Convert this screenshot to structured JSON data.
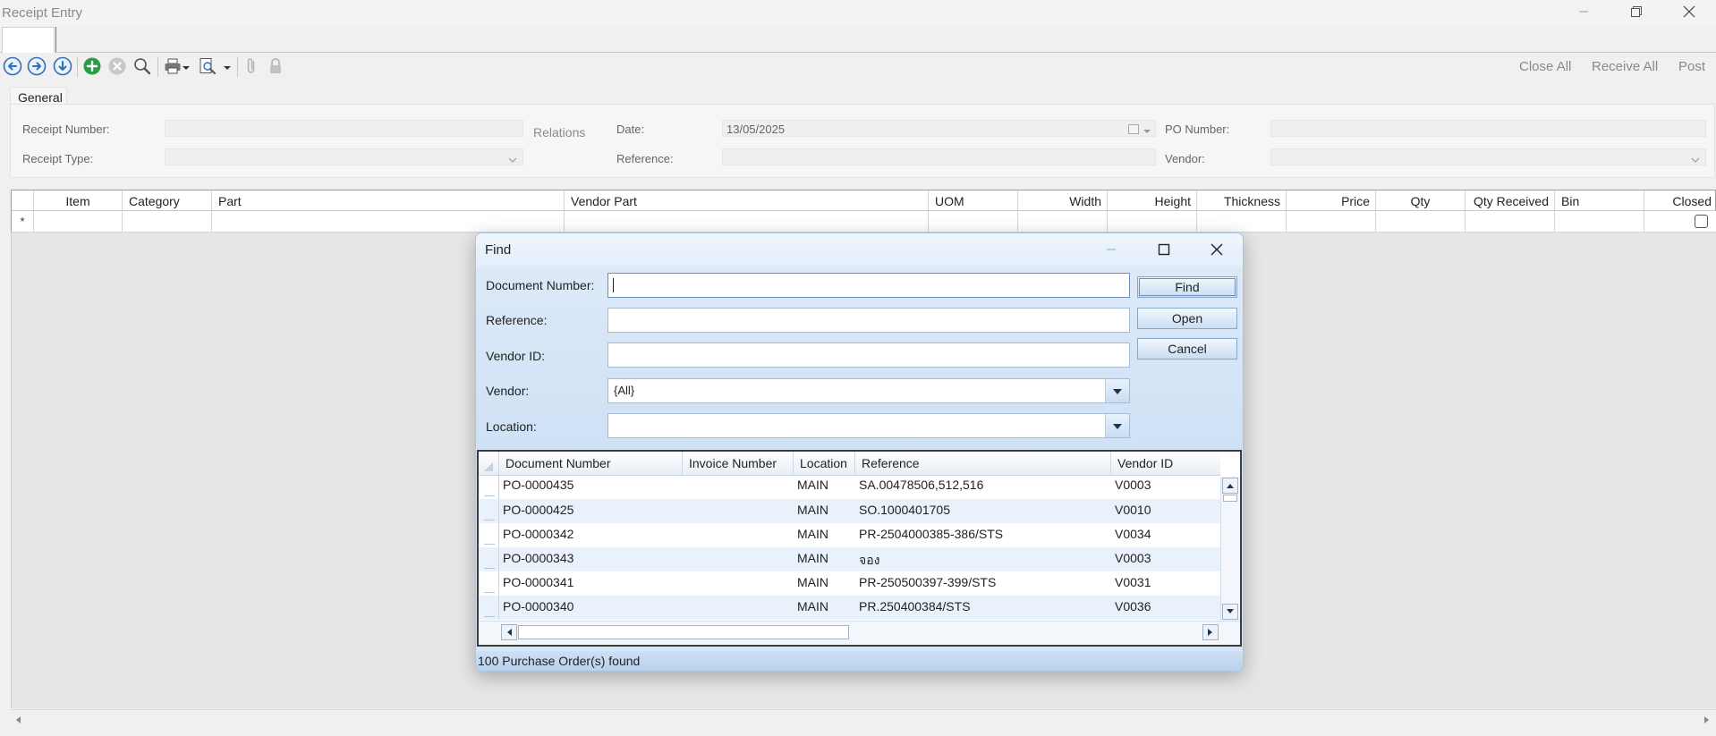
{
  "window": {
    "title": "Receipt Entry",
    "controls": [
      "minimize-icon",
      "restore-icon",
      "close-icon"
    ]
  },
  "toolbar": {
    "icons": [
      "arrow-left-icon",
      "arrow-right-icon",
      "arrow-down-icon",
      "add-icon",
      "delete-icon",
      "search-icon",
      "print-icon",
      "dropdown-arrow-icon",
      "preview-icon",
      "dropdown-arrow-icon",
      "paperclip-icon",
      "lock-icon"
    ],
    "close_all": "Close All",
    "receive_all": "Receive All",
    "post": "Post"
  },
  "form": {
    "tab_general": "General",
    "receipt_number_label": "Receipt Number:",
    "receipt_type_label": "Receipt Type:",
    "relations_label": "Relations",
    "date_label": "Date:",
    "date_value": "13/05/2025",
    "reference_label": "Reference:",
    "po_number_label": "PO Number:",
    "vendor_label": "Vendor:"
  },
  "grid": {
    "columns": [
      "Item",
      "Category",
      "Part",
      "Vendor Part",
      "UOM",
      "Width",
      "Height",
      "Thickness",
      "Price",
      "Qty",
      "Qty Received",
      "Bin",
      "Closed"
    ],
    "new_row_marker": "*"
  },
  "dialog": {
    "title": "Find",
    "document_number_label": "Document Number:",
    "document_number_value": "",
    "reference_label": "Reference:",
    "reference_value": "",
    "vendor_id_label": "Vendor ID:",
    "vendor_id_value": "",
    "vendor_label": "Vendor:",
    "vendor_value": "{All}",
    "location_label": "Location:",
    "location_value": "",
    "find_button": "Find",
    "open_button": "Open",
    "cancel_button": "Cancel",
    "columns": [
      "Document Number",
      "Invoice Number",
      "Location",
      "Reference",
      "Vendor ID"
    ],
    "rows": [
      {
        "document_number": "PO-0000435",
        "invoice_number": "",
        "location": "MAIN",
        "reference": "SA.00478506,512,516",
        "vendor_id": "V0003"
      },
      {
        "document_number": "PO-0000425",
        "invoice_number": "",
        "location": "MAIN",
        "reference": "SO.1000401705",
        "vendor_id": "V0010"
      },
      {
        "document_number": "PO-0000342",
        "invoice_number": "",
        "location": "MAIN",
        "reference": "PR-2504000385-386/STS",
        "vendor_id": "V0034"
      },
      {
        "document_number": "PO-0000343",
        "invoice_number": "",
        "location": "MAIN",
        "reference": "จอง",
        "vendor_id": "V0003"
      },
      {
        "document_number": "PO-0000341",
        "invoice_number": "",
        "location": "MAIN",
        "reference": "PR-250500397-399/STS",
        "vendor_id": "V0031"
      },
      {
        "document_number": "PO-0000340",
        "invoice_number": "",
        "location": "MAIN",
        "reference": "PR.250400384/STS",
        "vendor_id": "V0036"
      }
    ],
    "status": "100 Purchase Order(s) found"
  }
}
